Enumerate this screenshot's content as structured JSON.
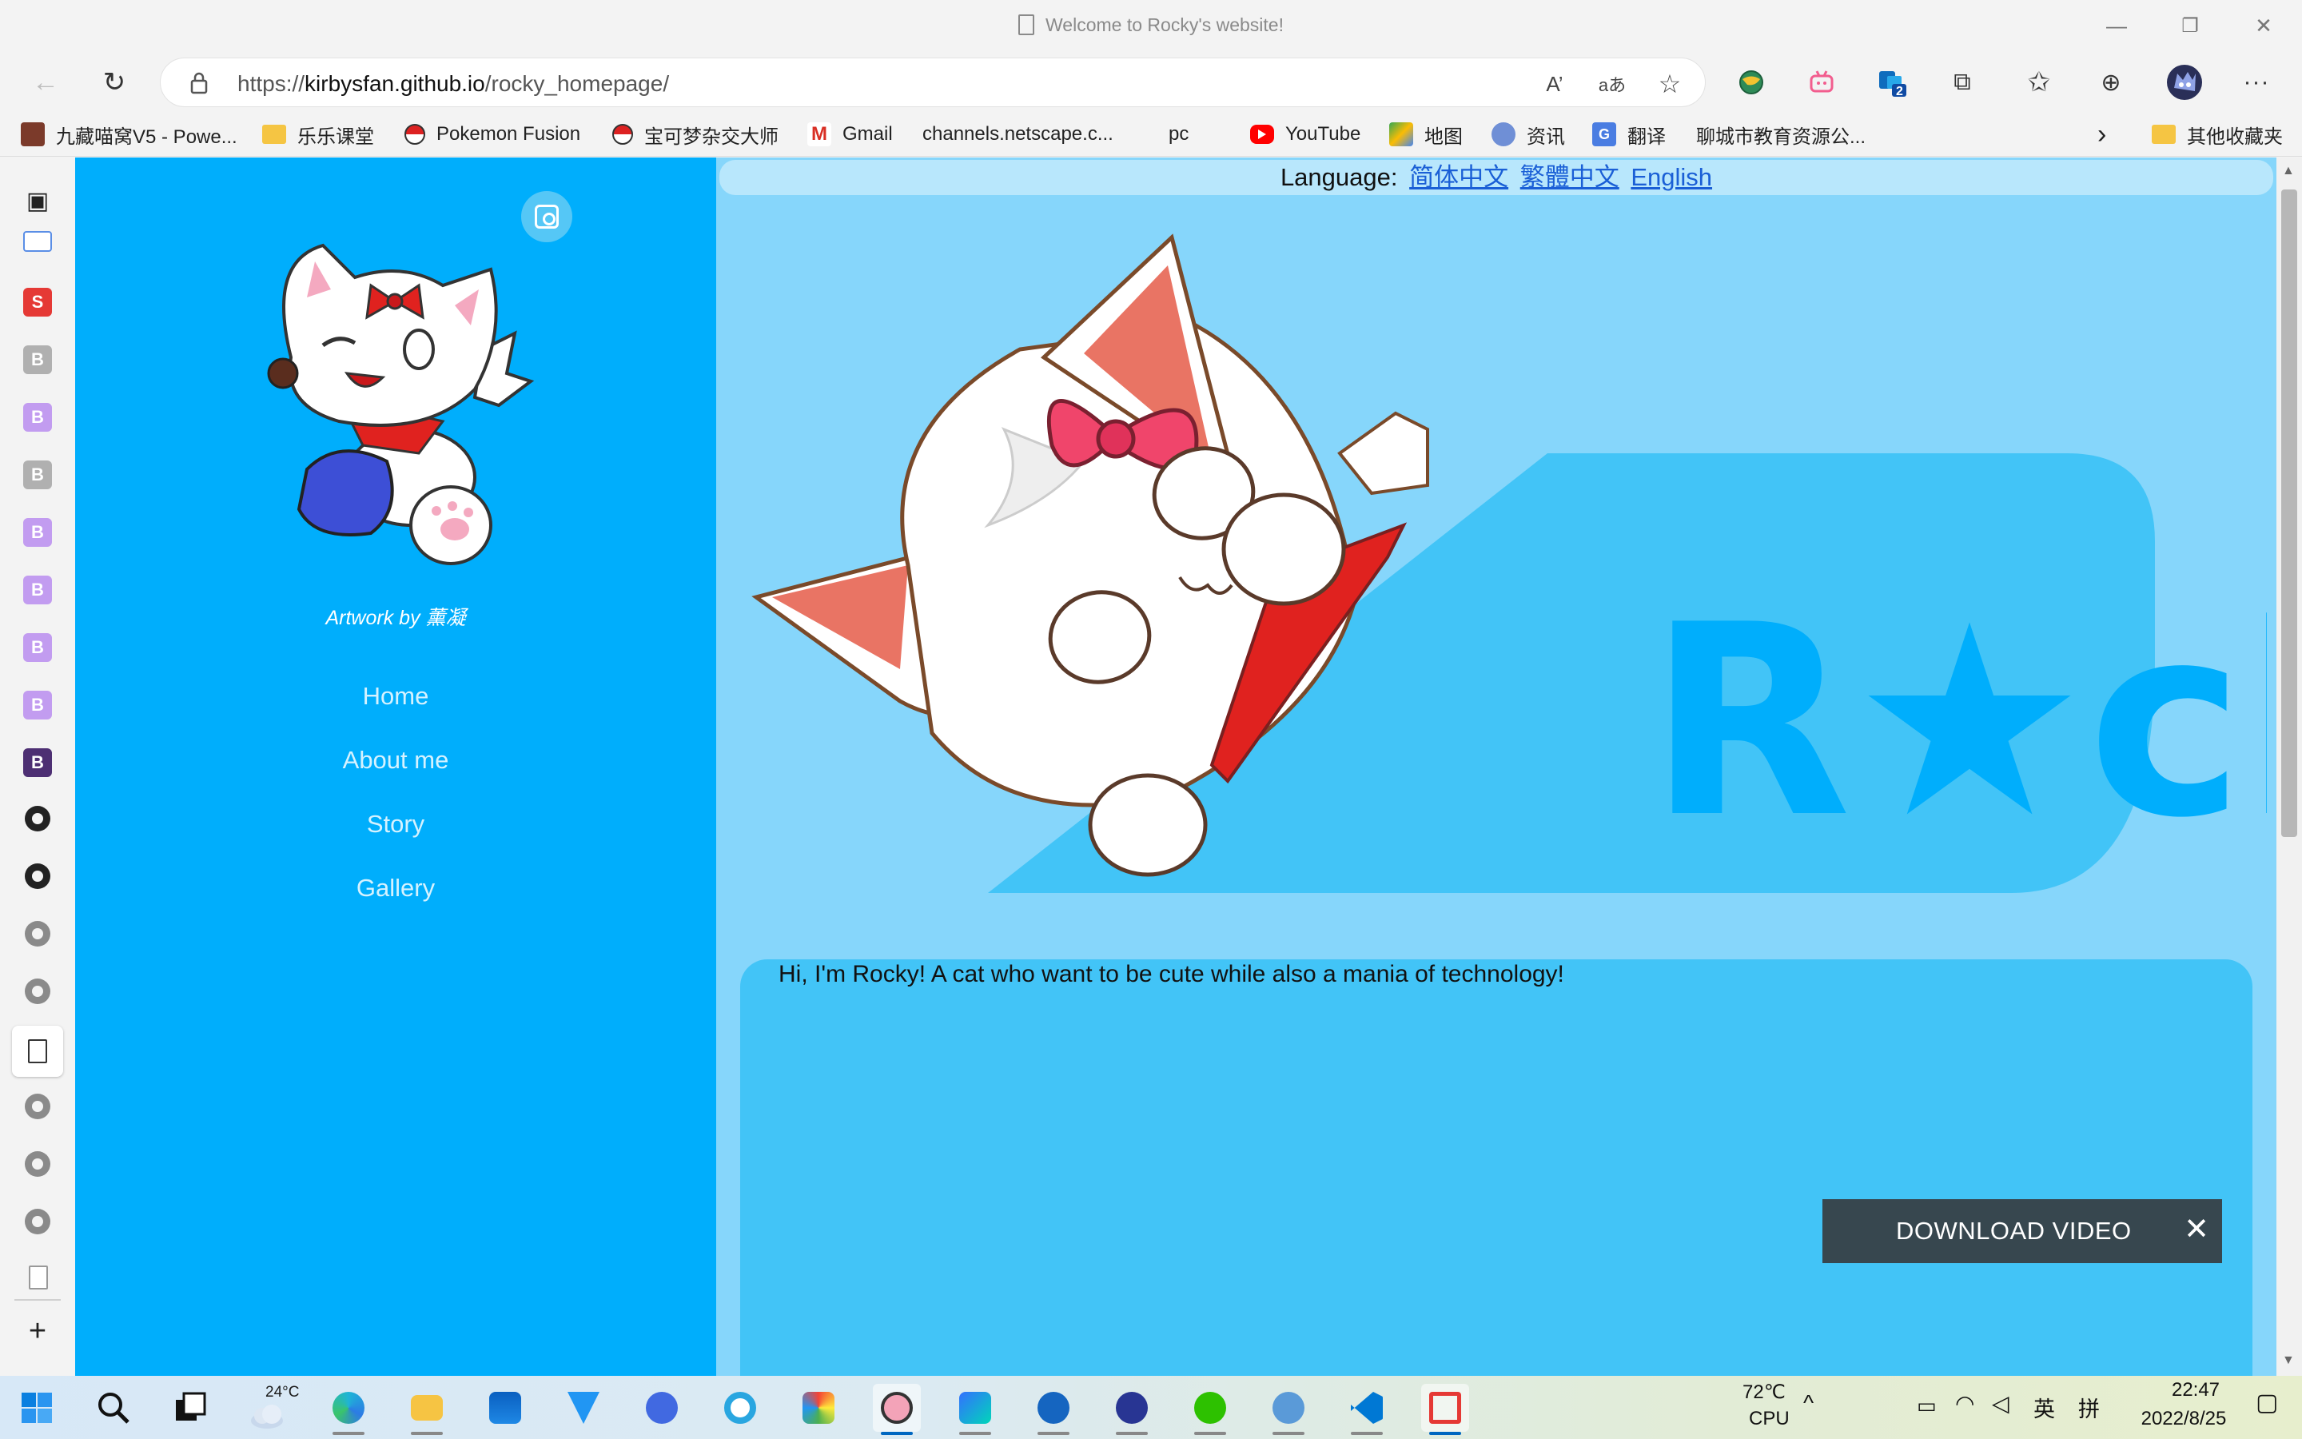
{
  "window": {
    "title": "Welcome to Rocky's website!",
    "minimize": "—",
    "maximize": "❐",
    "close": "✕"
  },
  "navigation": {
    "back": "←",
    "refresh": "↻",
    "url_prefix": "https://",
    "url_host": "kirbysfan.github.io",
    "url_path": "/rocky_homepage/"
  },
  "toolbar_icons": [
    "read-aloud-icon",
    "translate-icon",
    "add-favorite-icon",
    "extension-globe-icon",
    "extension-bilibili-icon",
    "extension-outlook-icon",
    "extensions-icon",
    "favorites-icon",
    "collections-icon",
    "profile-avatar-icon",
    "more-icon"
  ],
  "toolbar": {
    "read_aloud": "A’",
    "translate": "aあ",
    "favorite": "☆",
    "extension_badge": "2",
    "extensions": "⧉",
    "favorites": "✩",
    "collections": "⊕",
    "more": "···"
  },
  "bookmarks": [
    {
      "label": "九藏喵窝V5 - Powe...",
      "icon": "cat-site-icon"
    },
    {
      "label": "乐乐课堂",
      "icon": "folder-icon"
    },
    {
      "label": "Pokemon Fusion",
      "icon": "pokeball-icon"
    },
    {
      "label": "宝可梦杂交大师",
      "icon": "pokeball-icon"
    },
    {
      "label": "Gmail",
      "icon": "gmail-icon"
    },
    {
      "label": "channels.netscape.c...",
      "icon": "page-icon"
    },
    {
      "label": "pc",
      "icon": "page-icon"
    },
    {
      "label": "YouTube",
      "icon": "youtube-icon"
    },
    {
      "label": "地图",
      "icon": "maps-icon"
    },
    {
      "label": "资讯",
      "icon": "news-icon"
    },
    {
      "label": "翻译",
      "icon": "translate-icon"
    },
    {
      "label": "聊城市教育资源公...",
      "icon": "page-icon"
    }
  ],
  "bookmarks_more": "›",
  "other_favorites": "其他收藏夹",
  "vertical_tabs": {
    "top_toggle": "▣",
    "s_tab": "S",
    "b_letter": "B",
    "new_tab": "+"
  },
  "sidebar": {
    "credit": "Artwork by 薰凝",
    "links": [
      "Home",
      "About me",
      "Story",
      "Gallery"
    ]
  },
  "language": {
    "label": "Language:",
    "options": [
      "简体中文",
      "繁體中文",
      "English"
    ]
  },
  "banner": {
    "logo_text": "R★cky"
  },
  "intro": {
    "text": "Hi, I'm Rocky! A cat who want to be cute while also a mania of technology!"
  },
  "download_video": {
    "label": "DOWNLOAD VIDEO",
    "close": "✕"
  },
  "taskbar": {
    "weather_temp": "24°C",
    "cpu_temp": "72℃",
    "cpu_label": "CPU",
    "ime_lang": "英",
    "ime_mode": "拼",
    "time": "22:47",
    "date": "2022/8/25"
  },
  "colors": {
    "sidebar_bg": "#00aefc",
    "main_bg": "#86d6fb",
    "intro_bg": "#42c4f7",
    "logo_blue": "#00aefc",
    "download_bg": "#37474f",
    "link_blue": "#1a5fd6"
  }
}
